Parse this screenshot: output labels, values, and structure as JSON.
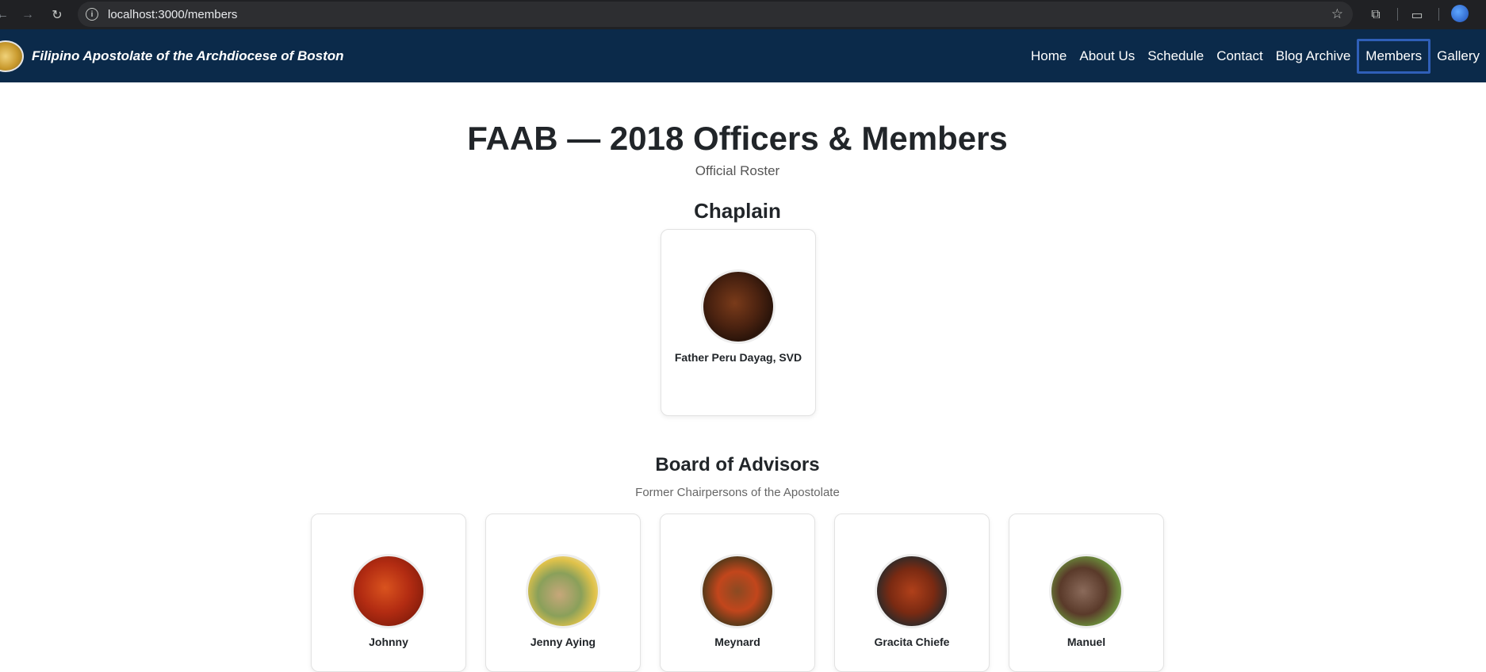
{
  "browser": {
    "url": "localhost:3000/members"
  },
  "header": {
    "brand": "Filipino Apostolate of the Archdiocese of Boston",
    "nav": [
      "Home",
      "About Us",
      "Schedule",
      "Contact",
      "Blog Archive",
      "Members",
      "Gallery"
    ],
    "active_nav": "Members"
  },
  "page": {
    "title": "FAAB — 2018 Officers & Members",
    "subtitle": "Official Roster"
  },
  "chaplain": {
    "heading": "Chaplain",
    "member": {
      "name": "Father Peru Dayag, SVD"
    }
  },
  "advisors": {
    "heading": "Board of Advisors",
    "subheading": "Former Chairpersons of the Apostolate",
    "members": [
      {
        "name": "Johnny"
      },
      {
        "name": "Jenny Aying"
      },
      {
        "name": "Meynard"
      },
      {
        "name": "Gracita Chiefe"
      },
      {
        "name": "Manuel"
      }
    ]
  },
  "colors": {
    "header_bg": "#0b2a4a",
    "active_nav_border": "#2f5fb8"
  }
}
